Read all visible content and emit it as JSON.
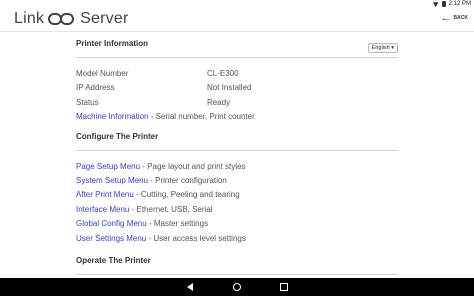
{
  "status_bar": {
    "time": "2:12 PM",
    "icons": [
      "wifi-icon",
      "battery-icon"
    ]
  },
  "header": {
    "logo_left": "Link",
    "logo_right": "Server",
    "back_label": "BACK",
    "back_icon": "arrow-left-icon"
  },
  "printer_information": {
    "title": "Printer Information",
    "language": "English",
    "rows": [
      {
        "key": "Model Number",
        "value": "CL-E300"
      },
      {
        "key": "IP Address",
        "value": "Not Installed"
      },
      {
        "key": "Status",
        "value": "Ready"
      }
    ],
    "machine_link": "Machine Information",
    "machine_desc": " - Serial number, Print counter"
  },
  "configure": {
    "title": "Configure The Printer",
    "items": [
      {
        "link": "Page Setup Menu",
        "desc": " - Page layout and print styles"
      },
      {
        "link": "System Setup Menu",
        "desc": " - Printer configuration"
      },
      {
        "link": "After Print Menu",
        "desc": " - Cutting, Peeling and tearing"
      },
      {
        "link": "Interface Menu",
        "desc": " - Ethernet, USB, Serial"
      },
      {
        "link": "Global Config Menu",
        "desc": " - Master settings"
      },
      {
        "link": "User Settings Menu",
        "desc": " - User access level settings"
      }
    ]
  },
  "operate": {
    "title": "Operate The Printer"
  },
  "colors": {
    "link": "#3b42c4",
    "nav_bar": "#000000",
    "text": "#555555"
  }
}
